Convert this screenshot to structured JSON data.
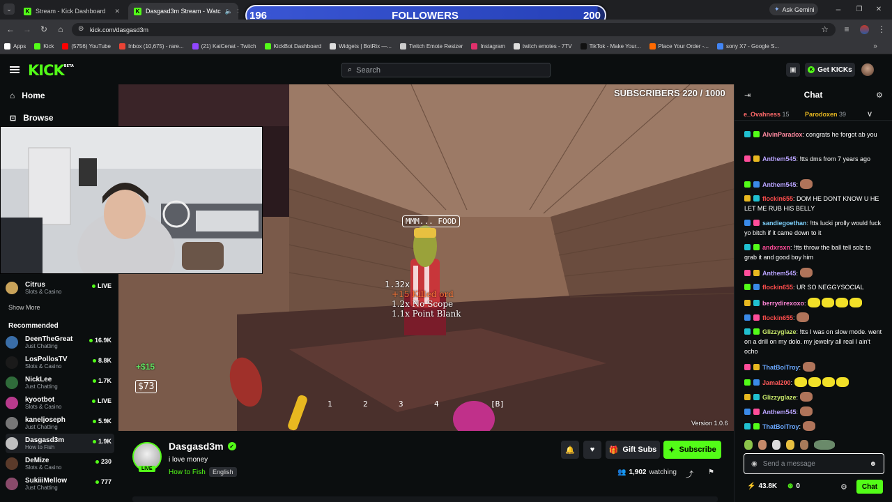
{
  "browser": {
    "tabs": [
      {
        "title": "Stream - Kick Dashboard"
      },
      {
        "title": "Dasgasd3m Stream - Watc"
      }
    ],
    "ask_gemini": "Ask Gemini",
    "url": "kick.com/dasgasd3m",
    "bookmarks": [
      "Apps",
      "Kick",
      "(5756) YouTube",
      "Inbox (10,675) - rare...",
      "(21) KaiCenat - Twitch",
      "KickBot Dashboard",
      "Widgets | BotRix —...",
      "Twitch Emote Resizer",
      "Instagram",
      "twitch emotes - 7TV",
      "TikTok - Make Your...",
      "Place Your Order -...",
      "sony X7 - Google S..."
    ],
    "bookmark_colors": [
      "#ffffff",
      "#53fc18",
      "#ff0000",
      "#ea4335",
      "#9146ff",
      "#53fc18",
      "#dddddd",
      "#cccccc",
      "#e1306c",
      "#dddddd",
      "#111111",
      "#ff6a00",
      "#4285f4"
    ]
  },
  "overlay": {
    "followers_current": "196",
    "followers_label": "FOLLOWERS",
    "followers_goal": "200",
    "followers_progress": 0.98,
    "subscribers_text": "SUBSCRIBERS 220 / 1000",
    "food_sign": "MMM... FOOD",
    "multiplier": "1.32x",
    "combo_lines": [
      "+15 Killed ord",
      "1.2x No Scope",
      "1.1x Point Blank"
    ],
    "cash_gain": "+$15",
    "cash_total": "$73",
    "slots": [
      "1",
      "2",
      "3",
      "4",
      "[B]"
    ],
    "version": "Version 1.0.6"
  },
  "header": {
    "logo": "KICK",
    "logo_beta": "BETA",
    "search_placeholder": "Search",
    "get_kicks": "Get KICKs"
  },
  "sidebar": {
    "home": "Home",
    "browse": "Browse",
    "following": [
      {
        "name": "Citrus",
        "category": "Slots & Casino",
        "viewers": "LIVE",
        "color": "#c9a35a"
      }
    ],
    "show_more": "Show More",
    "recommended_title": "Recommended",
    "recommended": [
      {
        "name": "DeenTheGreat",
        "category": "Just Chatting",
        "viewers": "16.9K",
        "color": "#3a6ea8"
      },
      {
        "name": "LosPollosTV",
        "category": "Slots & Casino",
        "viewers": "8.8K",
        "color": "#1a1a1a"
      },
      {
        "name": "NickLee",
        "category": "Just Chatting",
        "viewers": "1.7K",
        "color": "#2f6b3a"
      },
      {
        "name": "kyootbot",
        "category": "Slots & Casino",
        "viewers": "LIVE",
        "color": "#b83a8c"
      },
      {
        "name": "kaneljoseph",
        "category": "Just Chatting",
        "viewers": "5.9K",
        "color": "#777777"
      },
      {
        "name": "Dasgasd3m",
        "category": "How to Fish",
        "viewers": "1.9K",
        "color": "#bfbfbf"
      },
      {
        "name": "DeMize",
        "category": "Slots & Casino",
        "viewers": "230",
        "color": "#5a3a2a"
      },
      {
        "name": "SukiiiMellow",
        "category": "Just Chatting",
        "viewers": "777",
        "color": "#8a4a6a"
      }
    ]
  },
  "stream": {
    "name": "Dasgasd3m",
    "title": "i love money",
    "category": "How to Fish",
    "language": "English",
    "live_badge": "LIVE",
    "watching_count": "1,902",
    "watching_label": "watching",
    "gift_subs": "Gift Subs",
    "subscribe": "Subscribe"
  },
  "chat": {
    "title": "Chat",
    "top_gifters": [
      {
        "name": "e_Ovahness",
        "count": "15"
      },
      {
        "name": "Parodoxen",
        "count": "39"
      },
      {
        "name": "V",
        "count": ""
      }
    ],
    "messages": [
      {
        "user": "AlvinParadox",
        "color": "#ff8aa0",
        "text": "congrats he forgot ab you",
        "emotes": 0
      },
      {
        "user": "Anthem545",
        "color": "#b9a4ff",
        "text": "!tts dms from 7 years ago",
        "emotes": 0
      },
      {
        "user": "Anthem545",
        "color": "#b9a4ff",
        "text": "",
        "emotes": 1
      },
      {
        "user": "flockin655",
        "color": "#ff4d4d",
        "text": "DOM HE DONT KNOW U HE LET ME RUB HIS BELLY",
        "emotes": 0
      },
      {
        "user": "sandiegoethan",
        "color": "#7fd3ff",
        "text": "!tts lucki prolly would fuck yo bitch if it came down to it",
        "emotes": 0
      },
      {
        "user": "andxrsxn",
        "color": "#ff4d9a",
        "text": "!tts throw the ball tell solz to grab it and good boy him",
        "emotes": 0
      },
      {
        "user": "Anthem545",
        "color": "#b9a4ff",
        "text": "",
        "emotes": 1
      },
      {
        "user": "flockin655",
        "color": "#ff4d4d",
        "text": "UR SO NEGGYSOCIAL",
        "emotes": 0
      },
      {
        "user": "berrydirexoxo",
        "color": "#ff86d6",
        "text": "",
        "emotes": 4
      },
      {
        "user": "flockin655",
        "color": "#ff4d4d",
        "text": "",
        "emotes": 1
      },
      {
        "user": "Glizzyglaze",
        "color": "#c8e86a",
        "text": "!tts I was on slow mode. went on a drill on my dolo. my jewelry all real I ain't ocho",
        "emotes": 0
      },
      {
        "user": "ThatBoiTroy",
        "color": "#6aa8ff",
        "text": "",
        "emotes": 1
      },
      {
        "user": "Jamal200",
        "color": "#ff5a5a",
        "text": "",
        "emotes": 4
      },
      {
        "user": "Glizzyglaze",
        "color": "#c8e86a",
        "text": "",
        "emotes": 1
      },
      {
        "user": "Anthem545",
        "color": "#b9a4ff",
        "text": "",
        "emotes": 1
      },
      {
        "user": "ThatBoiTroy",
        "color": "#6aa8ff",
        "text": "",
        "emotes": 1
      }
    ],
    "input_placeholder": "Send a message",
    "kicks_balance": "43.8K",
    "points": "0",
    "send_button": "Chat"
  }
}
